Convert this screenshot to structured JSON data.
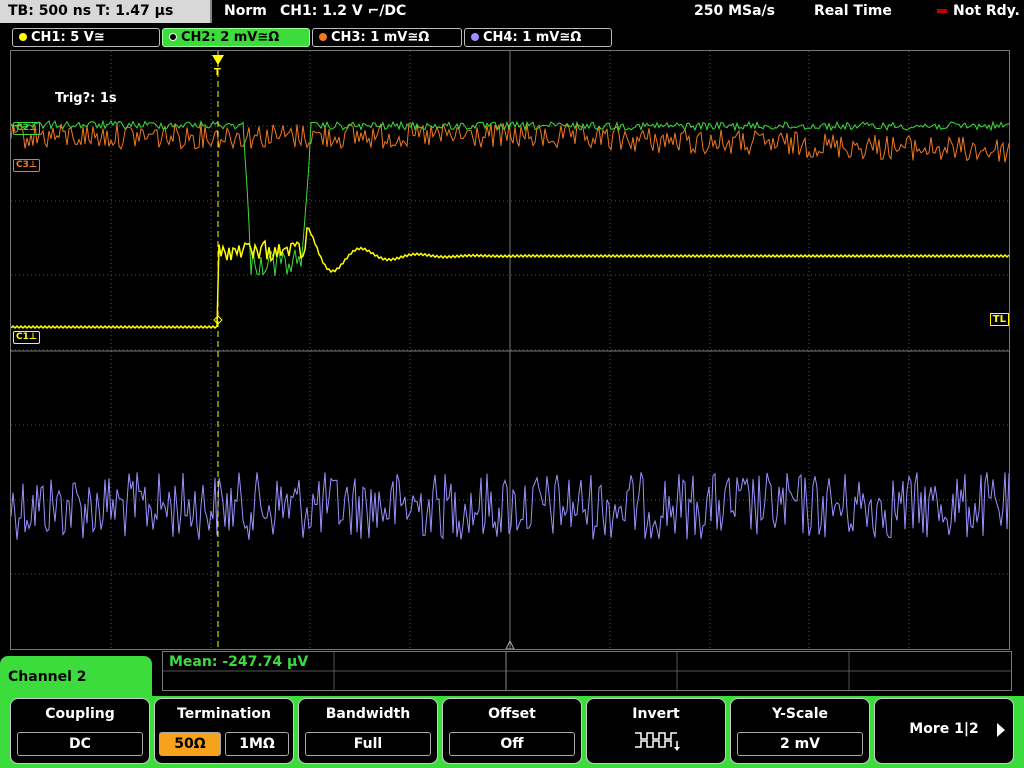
{
  "topbar": {
    "timebase": "TB: 500 ns  T: 1.47 µs",
    "trigger_mode": "Norm",
    "trigger_source": "CH1: 1.2 V ⌐/DC",
    "sample_rate": "250 MSa/s",
    "acq_mode": "Real Time",
    "status": "Not Rdy."
  },
  "channel_tabs": [
    {
      "label": "CH1: 5 V≅",
      "color": "#ffff00",
      "active": false
    },
    {
      "label": "CH2: 2 mV≅Ω",
      "color": "#3cdc3c",
      "active": true
    },
    {
      "label": "CH3: 1 mV≅Ω",
      "color": "#f07820",
      "active": false
    },
    {
      "label": "CH4: 1 mV≅Ω",
      "color": "#9a90ff",
      "active": false
    }
  ],
  "screen": {
    "trigger_label": "Trig?: 1s",
    "ch1_marker": "C1⊥",
    "ch3_marker": "C3⊥",
    "ch2_marker": "C2⊥",
    "tl_marker": "TL"
  },
  "measurement": {
    "text": "Mean: -247.74 µV"
  },
  "menu": {
    "title": "Channel 2"
  },
  "softkeys": {
    "coupling": {
      "label": "Coupling",
      "value": "DC"
    },
    "termination": {
      "label": "Termination",
      "options": [
        "50Ω",
        "1MΩ"
      ],
      "selected": "50Ω"
    },
    "bandwidth": {
      "label": "Bandwidth",
      "value": "Full"
    },
    "offset": {
      "label": "Offset",
      "value": "Off"
    },
    "invert": {
      "label": "Invert",
      "icon": "invert-waveform-icon"
    },
    "yscale": {
      "label": "Y-Scale",
      "value": "2 mV"
    },
    "more": {
      "label": "More 1|2"
    }
  },
  "colors": {
    "ch1": "#ffff00",
    "ch2": "#3cdc3c",
    "ch3": "#f07820",
    "ch4": "#9a90ff",
    "accent": "#f7a21b"
  }
}
